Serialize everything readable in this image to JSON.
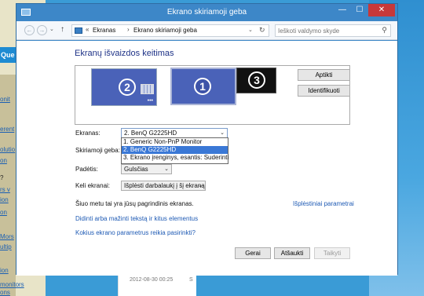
{
  "background": {
    "left_header": "Que",
    "left_snippets": [
      "onit",
      "erent",
      "olutio",
      "on",
      "?",
      "rs v",
      "ion",
      "on",
      "Mors",
      "ultip",
      "ion",
      "monitors",
      "ons"
    ],
    "middle_timestamp": "2012-08-30 00:25",
    "middle_flag": "S"
  },
  "window": {
    "title": "Ekrano skiriamoji geba",
    "controls": {
      "minimize": "—",
      "maximize": "☐",
      "close": "✕"
    }
  },
  "address": {
    "nav_back": "←",
    "nav_forward": "→",
    "nav_recent": "⌄",
    "nav_up": "↑",
    "breadcrumb_sep": "«",
    "crumbs": [
      "Ekranas",
      "Ekrano skiriamoji geba"
    ],
    "arrow": "›",
    "dropdown_arrow": "⌄",
    "refresh": "↻",
    "search_placeholder": "Ieškoti valdymo skyde",
    "search_icon": "⚲"
  },
  "main": {
    "heading": "Ekranų išvaizdos keitimas",
    "monitors": [
      {
        "number": "2"
      },
      {
        "number": "1"
      },
      {
        "number": "3"
      }
    ],
    "detect_button": "Aptikti",
    "identify_button": "Identifikuoti",
    "display_label": "Ekranas:",
    "display_value": "2. BenQ G2225HD",
    "display_options": [
      "1. Generic Non-PnP Monitor",
      "2. BenQ G2225HD",
      "3. Ekrano įrenginys, esantis: Suderinti"
    ],
    "resolution_label": "Skiriamoji geba:",
    "orientation_label": "Padėtis:",
    "orientation_value": "Gulsčias",
    "multiple_label": "Keli ekranai:",
    "multiple_value": "Išplėsti darbalaukį į šį ekraną",
    "info_text": "Šiuo metu tai yra jūsų pagrindinis ekranas.",
    "advanced_link": "Išplėstiniai parametrai",
    "link_text_size": "Didinti arba mažinti tekstą ir kitus elementus",
    "link_which_settings": "Kokius ekrano parametrus reikia pasirinkti?",
    "ok_button": "Gerai",
    "cancel_button": "Atšaukti",
    "apply_button": "Taikyti"
  },
  "colors": {
    "titlebar": "#3d87c8",
    "close_button": "#c7383a",
    "monitor": "#4a62b8",
    "selected_option": "#3a78d6",
    "link": "#1e5ab4"
  },
  "icons": [
    "window-icon",
    "back-arrow-icon",
    "forward-arrow-icon",
    "up-arrow-icon",
    "control-panel-icon",
    "refresh-icon",
    "search-icon",
    "chevron-down-icon"
  ]
}
